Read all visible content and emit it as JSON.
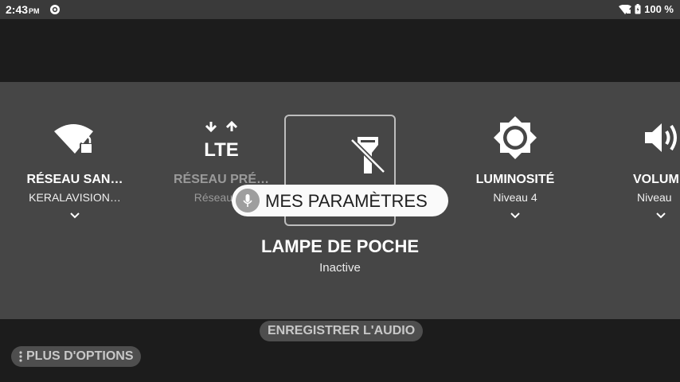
{
  "status_bar": {
    "time": "2:43",
    "ampm": "PM",
    "battery": "100 %",
    "icons": [
      "settings-app-icon",
      "wifi-icon",
      "battery-icon"
    ]
  },
  "quick_settings": {
    "tiles": [
      {
        "title": "RÉSEAU SAN…",
        "subtitle": "KERALAVISION…",
        "icon": "wifi-locked-icon"
      },
      {
        "title": "RÉSEAU PRÉ…",
        "subtitle": "Réseaux S",
        "icon": "lte-icon"
      },
      {
        "title": "LAMPE DE POCHE",
        "subtitle": "Inactive",
        "icon": "flashlight-off-icon"
      },
      {
        "title": "LUMINOSITÉ",
        "subtitle": "Niveau 4",
        "icon": "brightness-icon"
      },
      {
        "title": "VOLUM",
        "subtitle": "Niveau",
        "icon": "volume-icon"
      }
    ]
  },
  "voice_overlay": {
    "label": "MES PARAMÈTRES",
    "icon": "mic-icon"
  },
  "chips": {
    "record_audio": "ENREGISTRER L'AUDIO",
    "more_options": "PLUS D'OPTIONS"
  },
  "colors": {
    "panel": "#464646",
    "background": "#1c1c1c",
    "status_bar": "#3a3a3a",
    "pill": "#fafafa"
  }
}
